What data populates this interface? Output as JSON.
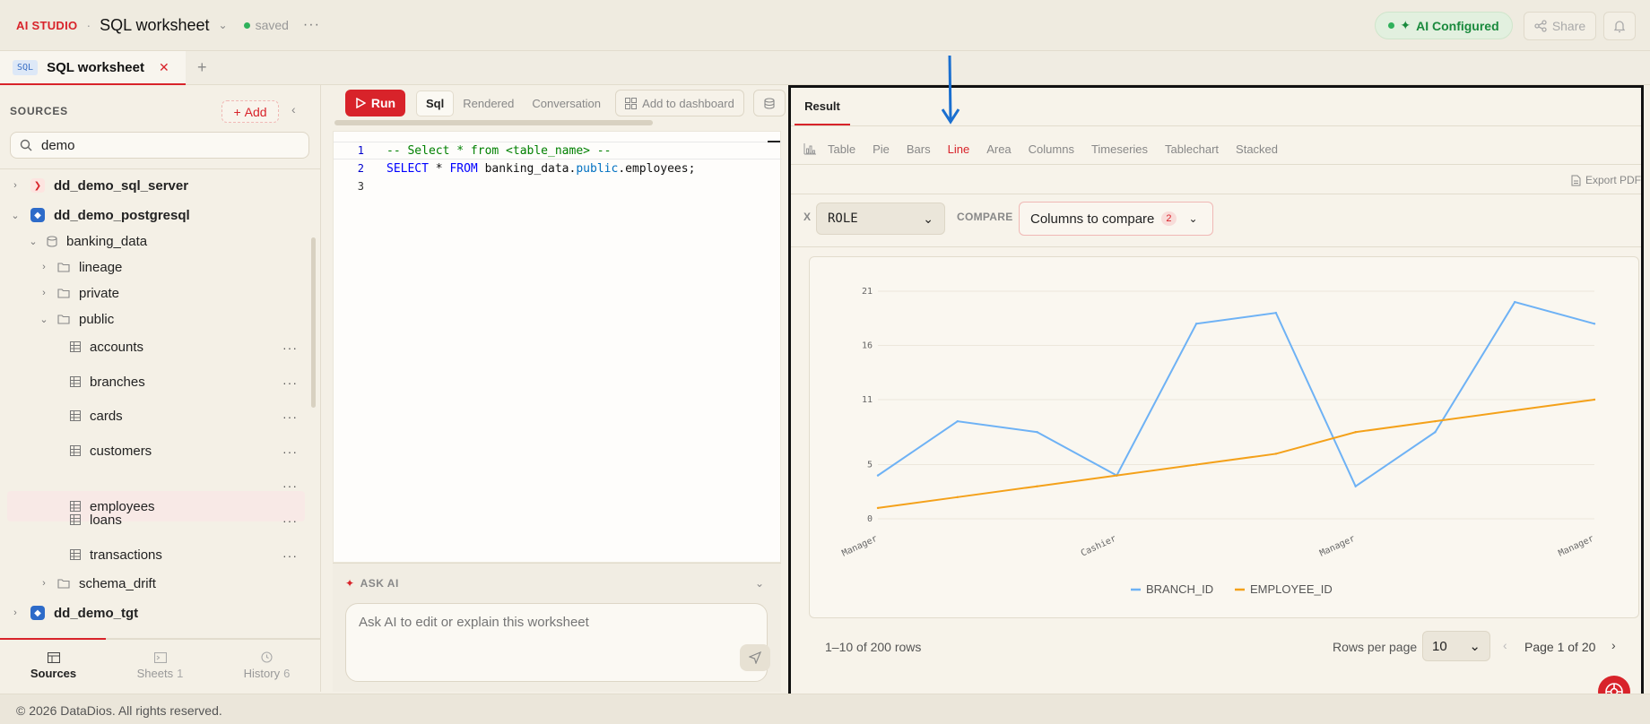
{
  "header": {
    "brand": "AI STUDIO",
    "title": "SQL worksheet",
    "status": "saved",
    "ai_badge": "AI Configured",
    "share": "Share"
  },
  "tabs": [
    {
      "tag": "SQL",
      "label": "SQL worksheet"
    }
  ],
  "sidebar": {
    "title": "SOURCES",
    "add": "Add",
    "search_value": "demo",
    "tree": [
      {
        "label": "dd_demo_sql_server"
      },
      {
        "label": "dd_demo_postgresql"
      },
      {
        "label": "banking_data"
      },
      {
        "label": "lineage"
      },
      {
        "label": "private"
      },
      {
        "label": "public"
      },
      {
        "label": "accounts"
      },
      {
        "label": "branches"
      },
      {
        "label": "cards"
      },
      {
        "label": "customers"
      },
      {
        "label": "employees"
      },
      {
        "label": "loans"
      },
      {
        "label": "transactions"
      },
      {
        "label": "schema_drift"
      },
      {
        "label": "dd_demo_tgt"
      }
    ],
    "nav": [
      {
        "label": "Sources",
        "count": ""
      },
      {
        "label": "Sheets",
        "count": "1"
      },
      {
        "label": "History",
        "count": "6"
      }
    ]
  },
  "editor": {
    "run": "Run",
    "modes": [
      "Sql",
      "Rendered",
      "Conversation"
    ],
    "add_to_dashboard": "Add to dashboard",
    "lines": [
      {
        "n": "1",
        "comment": "-- Select * from <table_name> --"
      },
      {
        "n": "2",
        "kw1": "SELECT",
        "star": " * ",
        "kw2": "FROM",
        "rest1": " banking_data.",
        "mid": "public",
        "rest2": ".employees;"
      },
      {
        "n": "3"
      }
    ]
  },
  "ask_ai": {
    "title": "ASK AI",
    "placeholder": "Ask AI to edit or explain this worksheet"
  },
  "result": {
    "tab": "Result",
    "chart_types": [
      "Table",
      "Pie",
      "Bars",
      "Line",
      "Area",
      "Columns",
      "Timeseries",
      "Tablechart",
      "Stacked"
    ],
    "active_type": "Line",
    "export": "Export PDF",
    "x_label": "X",
    "x_value": "ROLE",
    "compare_label": "COMPARE",
    "compare_button": "Columns to compare",
    "compare_count": "2",
    "rows_info": "1–10 of 200 rows",
    "rows_per_page_label": "Rows per page",
    "rows_per_page": "10",
    "page_label": "Page 1 of 20"
  },
  "chart_data": {
    "type": "line",
    "x_categories": [
      "Manager",
      "",
      "",
      "Cashier",
      "",
      "",
      "Manager",
      "",
      "",
      "Manager"
    ],
    "x_tick_labels": [
      {
        "index": 0,
        "label": "Manager"
      },
      {
        "index": 3,
        "label": "Cashier"
      },
      {
        "index": 6,
        "label": "Manager"
      },
      {
        "index": 9,
        "label": "Manager"
      }
    ],
    "y_ticks": [
      0,
      5,
      11,
      16,
      21
    ],
    "ylim": [
      0,
      21
    ],
    "series": [
      {
        "name": "BRANCH_ID",
        "color": "#6eb2f5",
        "values": [
          4,
          9,
          8,
          4,
          18,
          19,
          3,
          8,
          20,
          18
        ]
      },
      {
        "name": "EMPLOYEE_ID",
        "color": "#f4a11a",
        "values": [
          1,
          2,
          3,
          4,
          5,
          6,
          8,
          9,
          10,
          11
        ]
      }
    ],
    "legend_position": "bottom"
  },
  "footer": {
    "copyright": "© 2026 DataDios. All rights reserved."
  },
  "colors": {
    "accent": "#d8232a",
    "ai_green": "#2fb15b",
    "annotation_arrow": "#1a6fd0"
  }
}
